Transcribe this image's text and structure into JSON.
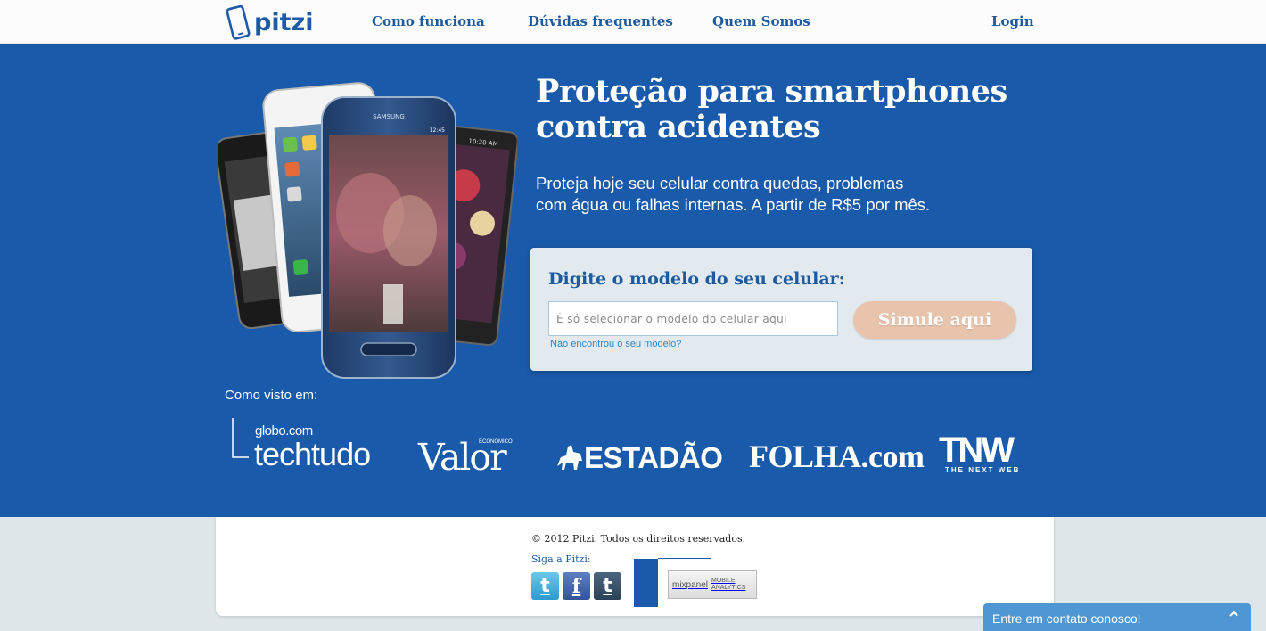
{
  "nav": {
    "logo_text": "pitzi",
    "links": [
      "Como funciona",
      "Dúvidas frequentes",
      "Quem Somos"
    ],
    "login": "Login"
  },
  "hero": {
    "headline": "Proteção para smartphones contra acidentes",
    "subtext": "Proteja hoje seu celular contra quedas, problemas\ncom  água ou falhas internas. A partir de R$5 por mês.",
    "phone_brand": "SAMSUNG",
    "phone_time": "12:45",
    "phone_time_2": "10:20 AM"
  },
  "simulate": {
    "title": "Digite o modelo do seu celular:",
    "input_placeholder": "É só selecionar o modelo do celular aqui",
    "input_value": "",
    "not_found_link": "Não encontrou o seu modelo?",
    "button_label": "Simule aqui"
  },
  "press": {
    "label": "Como visto em:",
    "globo": "globo.com",
    "techtudo": "techtudo",
    "valor": "Valor",
    "valor_tag": "ECONÔMICO",
    "estadao": "ESTADÃO",
    "folha": "FOLHA.com",
    "tnw": "TNW",
    "tnw_tag": "THE NEXT WEB"
  },
  "footer": {
    "copyright": "© 2012 Pitzi. Todos os direitos reservados.",
    "follow_label": "Siga a Pitzi:",
    "social": [
      "twitter-icon",
      "facebook-icon",
      "tumblr-icon"
    ],
    "mixpanel_name": "mixpanel",
    "mixpanel_tag": "MOBILE ANALYTICS"
  },
  "contact": {
    "label": "Entre em contato conosco!"
  },
  "colors": {
    "brand_blue": "#1a5aaa",
    "nav_text": "#1d5a9e",
    "button": "#e9c4ac",
    "contact": "#4f97d3"
  }
}
